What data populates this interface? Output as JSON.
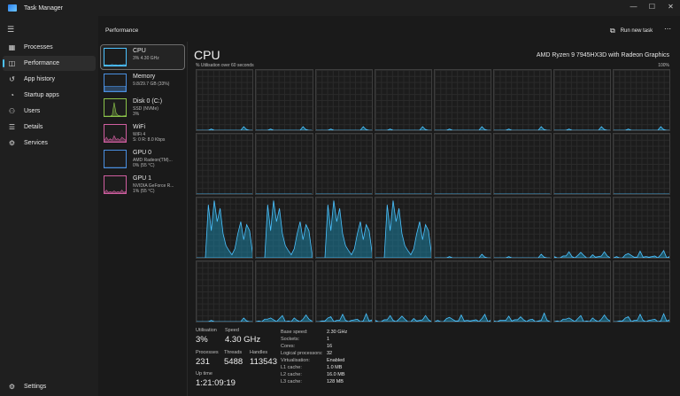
{
  "window": {
    "title": "Task Manager",
    "controls": [
      "minimize-icon",
      "maximize-icon",
      "close-icon"
    ]
  },
  "sidebar": {
    "items": [
      {
        "label": "Processes",
        "icon": "processes-grid-icon",
        "active": false
      },
      {
        "label": "Performance",
        "icon": "performance-graph-icon",
        "active": true
      },
      {
        "label": "App history",
        "icon": "history-icon",
        "active": false
      },
      {
        "label": "Startup apps",
        "icon": "startup-speedometer-icon",
        "active": false
      },
      {
        "label": "Users",
        "icon": "users-icon",
        "active": false
      },
      {
        "label": "Details",
        "icon": "details-list-icon",
        "active": false
      },
      {
        "label": "Services",
        "icon": "services-gear-icon",
        "active": false
      }
    ],
    "settings_label": "Settings"
  },
  "header": {
    "title": "Performance",
    "run_task_label": "Run new task"
  },
  "devices": [
    {
      "name": "CPU",
      "sub1": "3% 4.30 GHz",
      "sub2": "",
      "color": "#4cc2ff",
      "active": true,
      "values": [
        0.04,
        0.05,
        0.03,
        0.04,
        0.06,
        0.04,
        0.05,
        0.03,
        0.05,
        0.04,
        0.06,
        0.05
      ]
    },
    {
      "name": "Memory",
      "sub1": "9.8/29.7 GB (33%)",
      "sub2": "",
      "color": "#4a8fe0",
      "active": false,
      "values": [
        0.33,
        0.33,
        0.33,
        0.33,
        0.33,
        0.33,
        0.33,
        0.33,
        0.33,
        0.33,
        0.33,
        0.33
      ]
    },
    {
      "name": "Disk 0 (C:)",
      "sub1": "SSD (NVMe)",
      "sub2": "3%",
      "color": "#8bc34a",
      "active": false,
      "values": [
        0,
        0,
        0,
        0,
        0.05,
        0.9,
        0.2,
        0.05,
        0.02,
        0,
        0.02,
        0.03
      ]
    },
    {
      "name": "WiFi",
      "sub1": "WiFi 4",
      "sub2": "S: 0 R: 8.0 Kbps",
      "color": "#d05ea0",
      "active": false,
      "values": [
        0.1,
        0.3,
        0.1,
        0.2,
        0.1,
        0.4,
        0.15,
        0.2,
        0.1,
        0.3,
        0.2,
        0.1
      ]
    },
    {
      "name": "GPU 0",
      "sub1": "AMD Radeon(TM)...",
      "sub2": "0% (55 °C)",
      "color": "#4a8fe0",
      "active": false,
      "values": [
        0,
        0,
        0,
        0,
        0,
        0,
        0,
        0,
        0,
        0,
        0,
        0
      ]
    },
    {
      "name": "GPU 1",
      "sub1": "NVIDIA GeForce R...",
      "sub2": "1% (55 °C)",
      "color": "#d05ea0",
      "active": false,
      "values": [
        0.05,
        0.2,
        0.05,
        0.1,
        0.05,
        0.15,
        0.05,
        0.1,
        0.05,
        0.2,
        0.05,
        0.1
      ]
    }
  ],
  "main": {
    "title": "CPU",
    "model": "AMD Ryzen 9 7945HX3D with Radeon Graphics",
    "util_label": "% Utilisation over 60 seconds",
    "max_label": "100%"
  },
  "chart_data": {
    "type": "area",
    "title": "% Utilisation over 60 seconds",
    "ylim": [
      0,
      100
    ],
    "series_count": 32,
    "active_profile": [
      0,
      0,
      0,
      0,
      88,
      45,
      95,
      60,
      82,
      40,
      20,
      12,
      5,
      15,
      40,
      60,
      30,
      55,
      45,
      8
    ],
    "idle_profile": [
      0,
      0,
      0,
      0,
      0,
      2,
      0,
      0,
      0,
      0,
      0,
      0,
      0,
      0,
      0,
      0,
      6,
      1,
      0,
      0
    ],
    "spiky_profile": [
      0,
      0,
      0,
      2,
      4,
      8,
      2,
      1,
      3,
      10,
      2,
      0,
      1,
      4,
      2,
      0,
      3,
      12,
      2,
      1
    ],
    "cores": [
      {
        "name": "CPU 0",
        "profile": "idle"
      },
      {
        "name": "CPU 1",
        "profile": "idle"
      },
      {
        "name": "CPU 2",
        "profile": "idle"
      },
      {
        "name": "CPU 3",
        "profile": "idle"
      },
      {
        "name": "CPU 4",
        "profile": "idle"
      },
      {
        "name": "CPU 5",
        "profile": "idle"
      },
      {
        "name": "CPU 6",
        "profile": "idle"
      },
      {
        "name": "CPU 7",
        "profile": "idle"
      },
      {
        "name": "CPU 8",
        "profile": "flat"
      },
      {
        "name": "CPU 9",
        "profile": "flat"
      },
      {
        "name": "CPU 10",
        "profile": "flat"
      },
      {
        "name": "CPU 11",
        "profile": "flat"
      },
      {
        "name": "CPU 12",
        "profile": "flat"
      },
      {
        "name": "CPU 13",
        "profile": "flat"
      },
      {
        "name": "CPU 14",
        "profile": "flat"
      },
      {
        "name": "CPU 15",
        "profile": "flat"
      },
      {
        "name": "CPU 16",
        "profile": "active"
      },
      {
        "name": "CPU 17",
        "profile": "active"
      },
      {
        "name": "CPU 18",
        "profile": "active"
      },
      {
        "name": "CPU 19",
        "profile": "active"
      },
      {
        "name": "CPU 20",
        "profile": "idle"
      },
      {
        "name": "CPU 21",
        "profile": "idle"
      },
      {
        "name": "CPU 22",
        "profile": "spiky"
      },
      {
        "name": "CPU 23",
        "profile": "spiky"
      },
      {
        "name": "CPU 24",
        "profile": "idle"
      },
      {
        "name": "CPU 25",
        "profile": "spiky"
      },
      {
        "name": "CPU 26",
        "profile": "spiky"
      },
      {
        "name": "CPU 27",
        "profile": "spiky"
      },
      {
        "name": "CPU 28",
        "profile": "spiky"
      },
      {
        "name": "CPU 29",
        "profile": "spiky"
      },
      {
        "name": "CPU 30",
        "profile": "spiky"
      },
      {
        "name": "CPU 31",
        "profile": "spiky"
      }
    ]
  },
  "stats": {
    "utilisation_label": "Utilisation",
    "utilisation": "3%",
    "speed_label": "Speed",
    "speed": "4.30 GHz",
    "processes_label": "Processes",
    "processes": "231",
    "threads_label": "Threads",
    "threads": "5488",
    "handles_label": "Handles",
    "handles": "113543",
    "uptime_label": "Up time",
    "uptime": "1:21:09:19"
  },
  "specs": [
    {
      "label": "Base speed:",
      "value": "2.30 GHz"
    },
    {
      "label": "Sockets:",
      "value": "1"
    },
    {
      "label": "Cores:",
      "value": "16"
    },
    {
      "label": "Logical processors:",
      "value": "32"
    },
    {
      "label": "Virtualisation:",
      "value": "Enabled"
    },
    {
      "label": "L1 cache:",
      "value": "1.0 MB"
    },
    {
      "label": "L2 cache:",
      "value": "16.0 MB"
    },
    {
      "label": "L3 cache:",
      "value": "128 MB"
    }
  ]
}
